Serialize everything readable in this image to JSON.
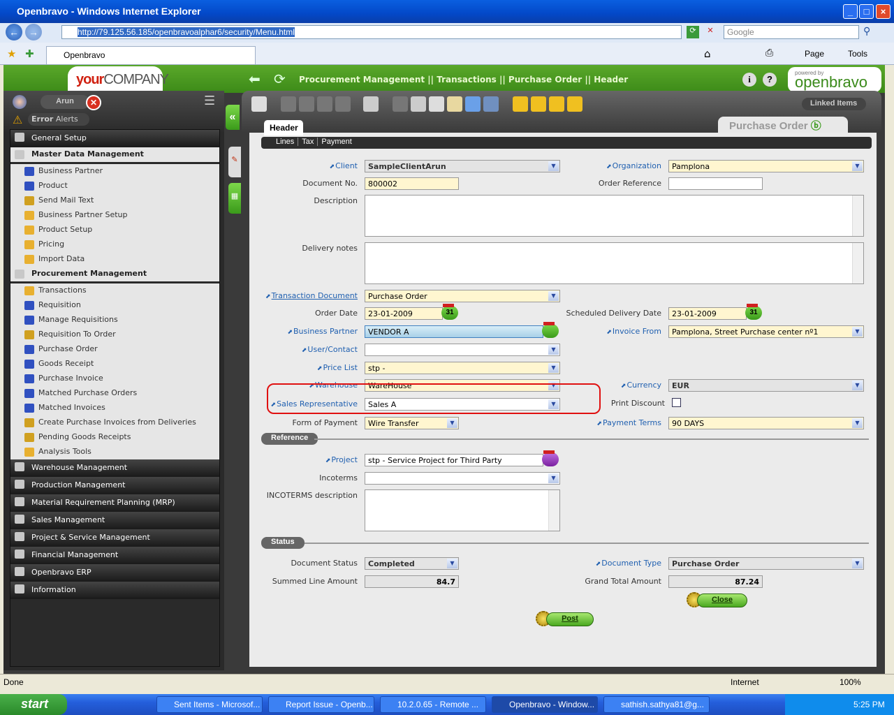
{
  "browser": {
    "title": "Openbravo - Windows Internet Explorer",
    "url": "http://79.125.56.185/openbravoalphar6/security/Menu.html",
    "search_placeholder": "Google",
    "tab": "Openbravo",
    "page_menu": "Page",
    "tools_menu": "Tools",
    "status": "Done",
    "zone": "Internet",
    "zoom": "100%"
  },
  "app": {
    "company_your": "your",
    "company_name": "COMPANY",
    "breadcrumb": "Procurement Management || Transactions || Purchase Order || Header",
    "powered_by": "powered by",
    "brand": "openbravo",
    "user": "Arun",
    "alerts_error": "Error",
    "alerts_label": "Alerts",
    "linked_items": "Linked Items",
    "window_tab": "Purchase Order",
    "header_tab": "Header",
    "subtabs": [
      "Lines",
      "Tax",
      "Payment"
    ]
  },
  "menu": [
    {
      "label": "General Setup",
      "kind": "sec"
    },
    {
      "label": "Master Data Management",
      "kind": "open"
    },
    {
      "label": "Business Partner",
      "kind": "l2",
      "icon": "report"
    },
    {
      "label": "Product",
      "kind": "l2",
      "icon": "report"
    },
    {
      "label": "Send Mail Text",
      "kind": "l2",
      "icon": "process"
    },
    {
      "label": "Business Partner Setup",
      "kind": "l2",
      "icon": "folder"
    },
    {
      "label": "Product Setup",
      "kind": "l2",
      "icon": "folder"
    },
    {
      "label": "Pricing",
      "kind": "l2",
      "icon": "folder"
    },
    {
      "label": "Import Data",
      "kind": "l2",
      "icon": "folder"
    },
    {
      "label": "Procurement Management",
      "kind": "open"
    },
    {
      "label": "Transactions",
      "kind": "l2",
      "icon": "folder-open"
    },
    {
      "label": "Requisition",
      "kind": "l3",
      "icon": "report"
    },
    {
      "label": "Manage Requisitions",
      "kind": "l3",
      "icon": "report"
    },
    {
      "label": "Requisition To Order",
      "kind": "l3",
      "icon": "process"
    },
    {
      "label": "Purchase Order",
      "kind": "l3",
      "icon": "report"
    },
    {
      "label": "Goods Receipt",
      "kind": "l3",
      "icon": "report"
    },
    {
      "label": "Purchase Invoice",
      "kind": "l3",
      "icon": "report"
    },
    {
      "label": "Matched Purchase Orders",
      "kind": "l3",
      "icon": "report"
    },
    {
      "label": "Matched Invoices",
      "kind": "l3",
      "icon": "report"
    },
    {
      "label": "Create Purchase Invoices from Deliveries",
      "kind": "l3",
      "icon": "process"
    },
    {
      "label": "Pending Goods Receipts",
      "kind": "l3",
      "icon": "process"
    },
    {
      "label": "Analysis Tools",
      "kind": "l2",
      "icon": "folder"
    },
    {
      "label": "Warehouse Management",
      "kind": "sec"
    },
    {
      "label": "Production Management",
      "kind": "sec"
    },
    {
      "label": "Material Requirement Planning (MRP)",
      "kind": "sec"
    },
    {
      "label": "Sales Management",
      "kind": "sec"
    },
    {
      "label": "Project & Service Management",
      "kind": "sec"
    },
    {
      "label": "Financial Management",
      "kind": "sec"
    },
    {
      "label": "Openbravo ERP",
      "kind": "sec"
    },
    {
      "label": "Information",
      "kind": "sec"
    }
  ],
  "form": {
    "fields": [
      {
        "label": "Client",
        "value": "SampleClientArun",
        "type": "select ro",
        "link": true
      },
      {
        "label": "Organization",
        "value": "Pamplona",
        "type": "select req",
        "link": true
      },
      {
        "label": "Document No.",
        "value": "800002",
        "type": "req"
      },
      {
        "label": "Order Reference",
        "value": "",
        "type": ""
      },
      {
        "label": "Description",
        "value": "",
        "type": "ta"
      },
      {
        "label": "Delivery notes",
        "value": "",
        "type": "ta"
      },
      {
        "label": "Transaction Document",
        "value": "Purchase Order",
        "type": "select req",
        "link": true,
        "underline": true
      },
      {
        "label": "Order Date",
        "value": "23-01-2009",
        "type": "req date"
      },
      {
        "label": "Scheduled Delivery Date",
        "value": "23-01-2009",
        "type": "req date"
      },
      {
        "label": "Business Partner",
        "value": "VENDOR A",
        "type": "bp",
        "link": true
      },
      {
        "label": "Invoice From",
        "value": "Pamplona, Street Purchase center nº1",
        "type": "select req",
        "link": true
      },
      {
        "label": "User/Contact",
        "value": "",
        "type": "select",
        "link": true
      },
      {
        "label": "Price List",
        "value": "stp -",
        "type": "select req",
        "link": true
      },
      {
        "label": "Warehouse",
        "value": "WareHouse",
        "type": "select req",
        "link": true
      },
      {
        "label": "Currency",
        "value": "EUR",
        "type": "select ro",
        "link": true
      },
      {
        "label": "Sales Representative",
        "value": "Sales A",
        "type": "select",
        "link": true
      },
      {
        "label": "Print Discount",
        "value": "",
        "type": "check"
      },
      {
        "label": "Form of Payment",
        "value": "Wire Transfer",
        "type": "select req"
      },
      {
        "label": "Payment Terms",
        "value": "90 DAYS",
        "type": "select req",
        "link": true
      },
      {
        "label": "Project",
        "value": "stp - Service Project for Third Party",
        "type": "proj",
        "link": true
      },
      {
        "label": "Incoterms",
        "value": "",
        "type": "select"
      },
      {
        "label": "INCOTERMS description",
        "value": "",
        "type": "ta"
      },
      {
        "label": "Document Status",
        "value": "Completed",
        "type": "select ro"
      },
      {
        "label": "Document Type",
        "value": "Purchase Order",
        "type": "select ro",
        "link": true
      },
      {
        "label": "Summed Line Amount",
        "value": "84.7",
        "type": "num"
      },
      {
        "label": "Grand Total Amount",
        "value": "87.24",
        "type": "num"
      }
    ],
    "sections": [
      "Reference",
      "Status"
    ],
    "buttons": {
      "close": "Close",
      "post": "Post"
    }
  },
  "taskbar": {
    "start": "start",
    "tasks": [
      "Sent Items - Microsof...",
      "Report Issue - Openb...",
      "10.2.0.65 - Remote ...",
      "Openbravo - Window...",
      "sathish.sathya81@g..."
    ],
    "clock": "5:25 PM"
  }
}
